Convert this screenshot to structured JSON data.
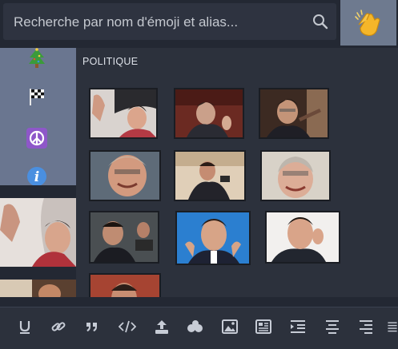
{
  "search": {
    "placeholder": "Recherche par nom d'émoji et alias..."
  },
  "header": {
    "emoji_toggle_icon": "clapping-hands-icon"
  },
  "sidebar": {
    "categories": [
      {
        "icon": "christmas-tree-icon"
      },
      {
        "icon": "checkered-flag-icon"
      },
      {
        "icon": "peace-symbol-icon"
      },
      {
        "icon": "information-icon"
      }
    ]
  },
  "section": {
    "title": "POLITIQUE",
    "emojis": [
      {
        "name": "politique-emoji-1"
      },
      {
        "name": "politique-emoji-2"
      },
      {
        "name": "politique-emoji-3"
      },
      {
        "name": "politique-emoji-4"
      },
      {
        "name": "politique-emoji-5"
      },
      {
        "name": "politique-emoji-6"
      },
      {
        "name": "politique-emoji-7"
      },
      {
        "name": "politique-emoji-8"
      },
      {
        "name": "politique-emoji-9"
      },
      {
        "name": "politique-emoji-10"
      }
    ]
  },
  "toolbar": {
    "tools": [
      "underline-icon",
      "link-icon",
      "quote-icon",
      "code-icon",
      "upload-icon",
      "emoji-icon",
      "image-icon",
      "newspaper-icon",
      "indent-icon",
      "align-center-icon",
      "align-right-icon",
      "more-icon"
    ]
  },
  "colors": {
    "accent": "#6e7a8f",
    "sidebar": "#6a7690",
    "background": "#2c313c"
  }
}
